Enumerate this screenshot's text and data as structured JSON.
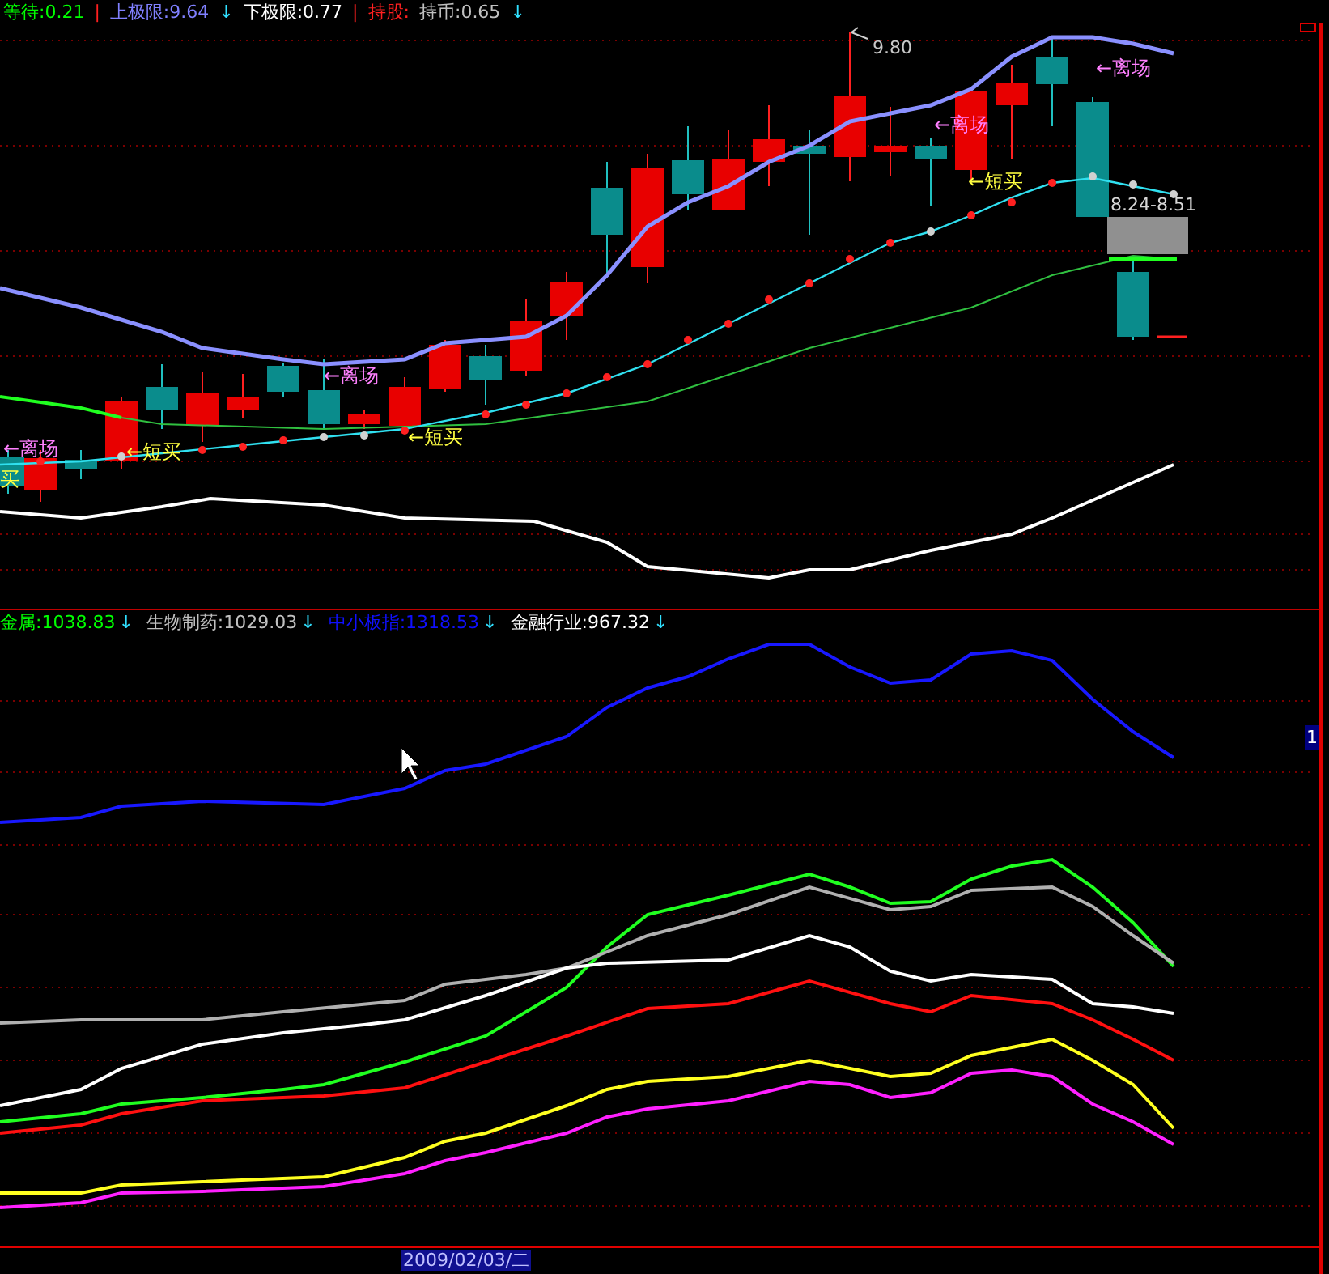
{
  "header": {
    "items": [
      {
        "kind": "value",
        "label": "等待:0.21",
        "color": "#00ff00"
      },
      {
        "kind": "separator",
        "label": "|",
        "color": "#ff2020"
      },
      {
        "kind": "value",
        "label": "上极限:9.64",
        "color": "#8080ff",
        "arrow": "↓"
      },
      {
        "kind": "value",
        "label": "下极限:0.77",
        "color": "#ffffff"
      },
      {
        "kind": "separator",
        "label": "|",
        "color": "#ff2020"
      },
      {
        "kind": "value",
        "label": "持股:",
        "color": "#ff2020"
      },
      {
        "kind": "value",
        "label": "持币:0.65",
        "color": "#c0c0c0",
        "arrow": "↓"
      }
    ]
  },
  "price_chart": {
    "high_label": "9.80",
    "range_label": "8.24-8.51",
    "signals": [
      {
        "kind": "exit",
        "text": "←离场"
      },
      {
        "kind": "exit",
        "text": "←离场"
      },
      {
        "kind": "exit",
        "text": "←离场"
      },
      {
        "kind": "exit",
        "text": "←离场"
      },
      {
        "kind": "buy",
        "text": "←短买"
      },
      {
        "kind": "buy",
        "text": "←短买"
      },
      {
        "kind": "buy",
        "text": "←短买"
      },
      {
        "kind": "buy",
        "text": "买"
      }
    ]
  },
  "legend": {
    "items": [
      {
        "label": "金属:1038.83",
        "color": "#00ff00",
        "arrow": "↓"
      },
      {
        "label": "生物制药:1029.03",
        "color": "#c0c0c0",
        "arrow": "↓"
      },
      {
        "label": "中小板指:1318.53",
        "color": "#1010ff",
        "arrow": "↓"
      },
      {
        "label": "金融行业:967.32",
        "color": "#ffffff",
        "arrow": "↓"
      }
    ]
  },
  "axis": {
    "scale_marker": "1",
    "date": "2009/02/03/二"
  }
}
